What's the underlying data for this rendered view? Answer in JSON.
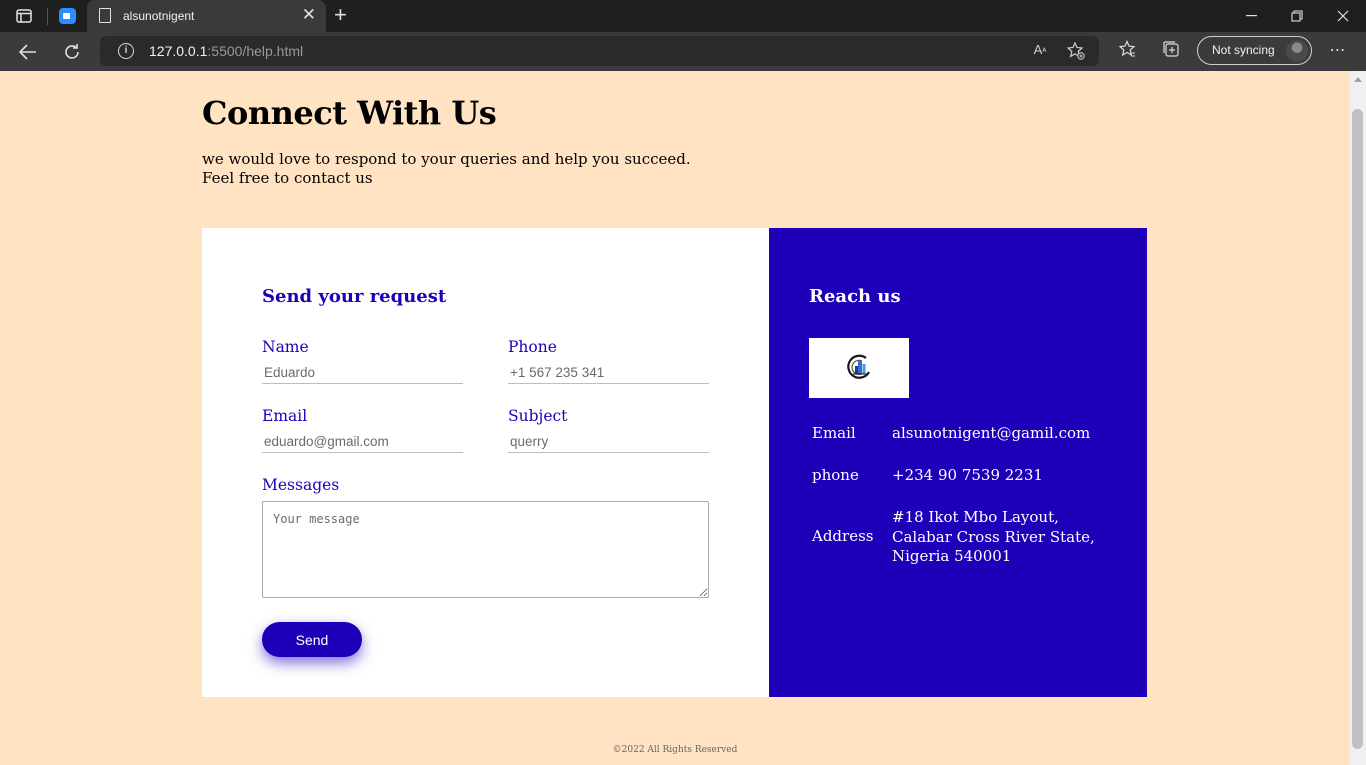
{
  "browser": {
    "tab_title": "alsunotnigent",
    "url_host": "127.0.0.1",
    "url_rest": ":5500/help.html",
    "sync_label": "Not syncing"
  },
  "page": {
    "title": "Connect With Us",
    "intro_line1": "we would love to respond to your queries and help you succeed.",
    "intro_line2": "Feel free to contact us"
  },
  "form": {
    "heading": "Send your request",
    "name_label": "Name",
    "name_placeholder": "Eduardo",
    "phone_label": "Phone",
    "phone_placeholder": "+1 567 235 341",
    "email_label": "Email",
    "email_placeholder": "eduardo@gmail.com",
    "subject_label": "Subject",
    "subject_placeholder": "querry",
    "messages_label": "Messages",
    "messages_placeholder": "Your message",
    "send_label": "Send"
  },
  "reach": {
    "heading": "Reach us",
    "email_label": "Email",
    "email_value": "alsunotnigent@gamil.com",
    "phone_label": "phone",
    "phone_value": "+234 90 7539 2231",
    "address_label": "Address",
    "address_value": "#18 Ikot Mbo Layout, Calabar Cross River State, Nigeria 540001"
  },
  "footer": {
    "text": "©2022 All Rights Reserved"
  },
  "colors": {
    "page_bg": "#ffe3c2",
    "accent": "#1e00b9"
  }
}
